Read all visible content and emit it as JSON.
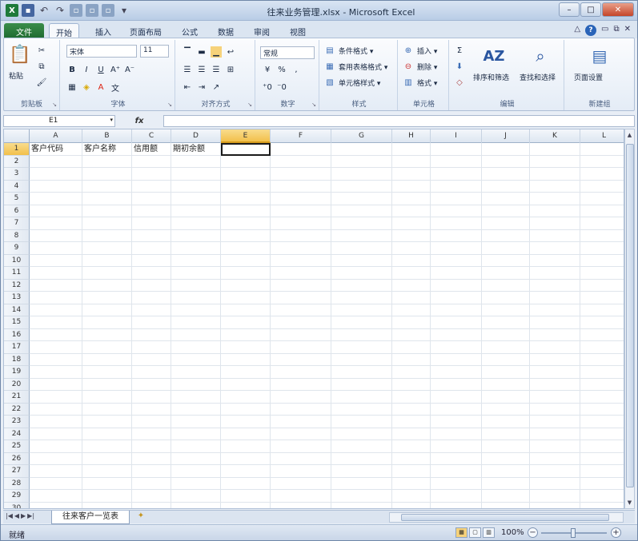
{
  "window": {
    "title": "往来业务管理.xlsx - Microsoft Excel"
  },
  "tabs": [
    "文件",
    "开始",
    "插入",
    "页面布局",
    "公式",
    "数据",
    "审阅",
    "视图"
  ],
  "ribbon": {
    "clipboard": {
      "label": "剪贴板",
      "paste": "粘贴"
    },
    "font": {
      "label": "字体",
      "font_name": "宋体",
      "font_size": "11"
    },
    "alignment": {
      "label": "对齐方式"
    },
    "number": {
      "label": "数字",
      "format": "常规"
    },
    "styles": {
      "label": "样式",
      "items": [
        "条件格式 ▾",
        "套用表格格式 ▾",
        "单元格样式 ▾"
      ]
    },
    "cells": {
      "label": "单元格",
      "items": [
        "插入 ▾",
        "删除 ▾",
        "格式 ▾"
      ]
    },
    "editing": {
      "label": "编辑",
      "sort_filter": "排序和筛选",
      "find_select": "查找和选择"
    },
    "new_group": {
      "label": "新建组",
      "page_setup": "页面设置"
    }
  },
  "formula_bar": {
    "name_box": "E1",
    "fx": "fx",
    "value": ""
  },
  "grid": {
    "columns": [
      "A",
      "B",
      "C",
      "D",
      "E",
      "F",
      "G",
      "H",
      "I",
      "J",
      "K",
      "L"
    ],
    "selected_column": "E",
    "rows": [
      "1",
      "2",
      "3",
      "4",
      "5",
      "6",
      "7",
      "8",
      "9",
      "10",
      "11",
      "12",
      "13",
      "14",
      "15",
      "16",
      "17",
      "18",
      "19",
      "20",
      "21",
      "22",
      "23",
      "24",
      "25",
      "26",
      "27",
      "28",
      "29",
      "30"
    ],
    "selected_row": "1",
    "row1": [
      "客户代码",
      "客户名称",
      "信用额",
      "期初余额",
      ""
    ]
  },
  "sheet_tabs": [
    "往来客户一览表"
  ],
  "status": {
    "ready": "就绪",
    "zoom": "100%"
  }
}
